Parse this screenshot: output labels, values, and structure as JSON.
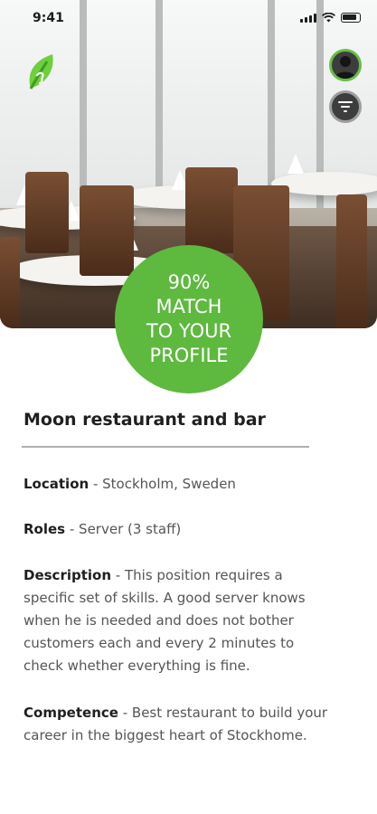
{
  "status_bar": {
    "time": "9:41"
  },
  "header": {
    "logo_icon": "leaf-logo-icon",
    "profile_icon": "user-avatar-icon",
    "filter_icon": "filter-icon"
  },
  "match": {
    "line1": "90%",
    "line2": "MATCH",
    "line3": "TO YOUR",
    "line4": "PROFILE"
  },
  "job": {
    "title": "Moon restaurant and bar",
    "location_label": "Location",
    "location_value": " - Stockholm, Sweden",
    "roles_label": "Roles",
    "roles_value": " - Server (3 staff)",
    "description_label": "Description",
    "description_value": " -  This position requires a specific set of skills. A good server knows when he is needed and does not bother customers each and every 2 minutes to check whether everything is fine.",
    "competence_label": "Competence",
    "competence_value": " - Best restaurant to build your career in the biggest heart of Stockhome."
  },
  "colors": {
    "accent_green": "#5eb93f",
    "avatar_ring": "#67bd49",
    "text_dark": "#1f1f1f",
    "text_muted": "#555555"
  }
}
